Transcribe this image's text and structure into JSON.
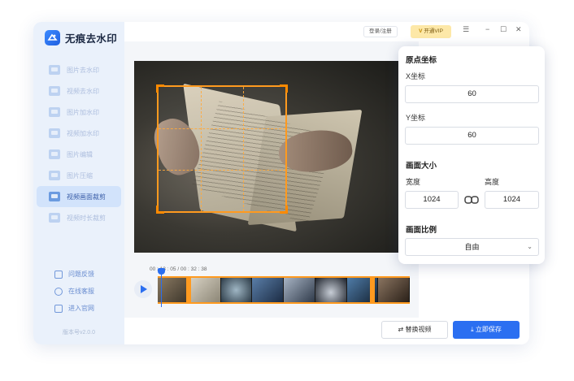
{
  "app": {
    "name": "无痕去水印",
    "version": "版本号v2.0.0"
  },
  "sidebar": {
    "items": [
      {
        "label": "图片去水印",
        "active": false
      },
      {
        "label": "视频去水印",
        "active": false
      },
      {
        "label": "图片加水印",
        "active": false
      },
      {
        "label": "视频加水印",
        "active": false
      },
      {
        "label": "图片编辑",
        "active": false
      },
      {
        "label": "图片压缩",
        "active": false
      },
      {
        "label": "视频画面裁剪",
        "active": true
      },
      {
        "label": "视频时长裁剪",
        "active": false
      }
    ],
    "links": [
      {
        "label": "问题反馈",
        "icon": "feedback-icon"
      },
      {
        "label": "在线客服",
        "icon": "support-icon"
      },
      {
        "label": "进入官网",
        "icon": "website-icon"
      }
    ]
  },
  "topbar": {
    "login_label": "登录/注册",
    "vip_label": "开通VIP",
    "vip_mark": "V"
  },
  "timeline": {
    "current": "00 : 13 : 05",
    "total": "00 : 32 : 38",
    "separator": "/"
  },
  "buttons": {
    "replace_video": "替换视频",
    "save_now": "立即保存"
  },
  "panel": {
    "origin_title": "原点坐标",
    "x_label": "X坐标",
    "x_value": "60",
    "y_label": "Y坐标",
    "y_value": "60",
    "size_title": "画面大小",
    "width_label": "宽度",
    "width_value": "1024",
    "height_label": "高度",
    "height_value": "1024",
    "ratio_title": "画面比例",
    "ratio_value": "自由"
  },
  "colors": {
    "accent": "#2b6ff1",
    "crop": "#ff9a1f",
    "vip": "#fde8a8",
    "sidebar_bg": "#eaf1fb"
  }
}
